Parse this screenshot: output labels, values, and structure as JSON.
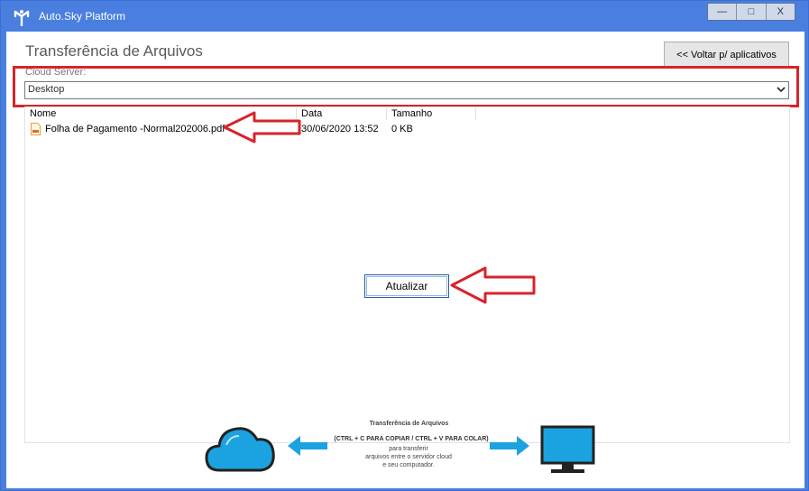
{
  "window": {
    "title": "Auto.Sky Platform",
    "controls": [
      "—",
      "□",
      "X"
    ]
  },
  "page": {
    "title": "Transferência de Arquivos",
    "back_button": "<< Voltar p/ aplicativos"
  },
  "cloud_server": {
    "label": "Cloud Server:",
    "selected": "Desktop"
  },
  "file_list": {
    "columns": [
      "Nome",
      "Data",
      "Tamanho"
    ],
    "rows": [
      {
        "name": "Folha de Pagamento -Normal202006.pdf",
        "date": "30/06/2020 13:52",
        "size": "0 KB"
      }
    ]
  },
  "refresh_button": "Atualizar",
  "banner": {
    "title": "Transferência de Arquivos",
    "shortcut": "(CTRL + C PARA COPIAR / CTRL + V PARA COLAR)",
    "line1": "para transferir",
    "line2": "arquivos entre o servidor cloud",
    "line3": "e seu computador."
  },
  "colors": {
    "titlebar": "#4a7fe0",
    "highlight_red": "#d8232a",
    "banner_blue": "#1aa3e0"
  }
}
